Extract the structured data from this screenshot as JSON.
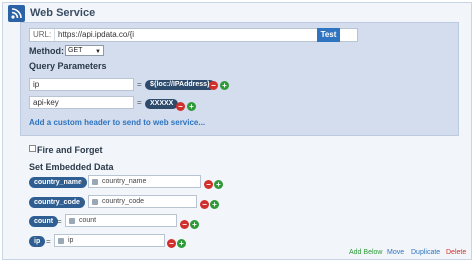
{
  "header": {
    "title": "Web Service",
    "icon": "rss-icon"
  },
  "url": {
    "prefix": "URL:",
    "value": "https://api.ipdata.co/{i",
    "test_label": "Test"
  },
  "method": {
    "label": "Method:",
    "selected": "GET"
  },
  "query": {
    "title": "Query Parameters",
    "params": [
      {
        "key": "ip",
        "value": "${loc://IPAddress}"
      },
      {
        "key": "api-key",
        "value": "XXXXX"
      }
    ],
    "add_header_label": "Add a custom header to send to web service..."
  },
  "fire_forget": {
    "label": "Fire and Forget"
  },
  "embedded": {
    "title": "Set Embedded Data",
    "rows": [
      {
        "label": "country_name",
        "value": "country_name"
      },
      {
        "label": "country_code",
        "value": "country_code"
      },
      {
        "label": "count",
        "value": "count"
      },
      {
        "label": "ip",
        "value": "ip"
      }
    ]
  },
  "footer": {
    "add_below": "Add Below",
    "move": "Move",
    "duplicate": "Duplicate",
    "delete": "Delete",
    "colors": {
      "add_below": "#2e9a37",
      "move": "#2f74c0",
      "duplicate": "#2f74c0",
      "delete": "#d0302c"
    }
  },
  "symbols": {
    "equals": "=",
    "minus": "−",
    "plus": "+"
  }
}
